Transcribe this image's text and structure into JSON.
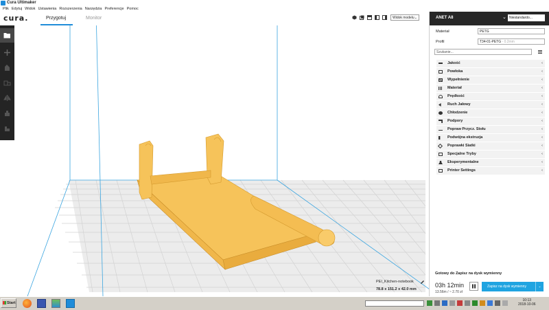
{
  "window": {
    "title": "Cura Ultimaker"
  },
  "menu": [
    "Plik",
    "Edytuj",
    "Widok",
    "Ustawienia",
    "Rozszerzenia",
    "Narzędzia",
    "Preferencje",
    "Pomoc"
  ],
  "header": {
    "logo": "cura.",
    "tabs": [
      {
        "label": "Przygotuj",
        "active": true
      },
      {
        "label": "Monitor",
        "active": false
      }
    ],
    "view_select": "Widok modelu",
    "view_buttons": [
      "3d-view-icon",
      "front-view-icon",
      "top-view-icon",
      "left-view-icon",
      "right-view-icon"
    ]
  },
  "left_tools": [
    "open-file-icon",
    "move-icon",
    "scale-icon",
    "rotate-icon",
    "mirror-icon",
    "per-model-settings-icon",
    "support-blocker-icon"
  ],
  "machine": {
    "name": "ANET A8",
    "extruder": "Niestandardo..."
  },
  "material": {
    "label": "Materiał",
    "value": "PETG"
  },
  "profile": {
    "label": "Profil",
    "value": "T34-01-PETG",
    "suffix": "- 0.2mm"
  },
  "search": {
    "placeholder": "Szukanie..."
  },
  "settings": [
    {
      "label": "Jakość",
      "icon": "quality-icon"
    },
    {
      "label": "Powłoka",
      "icon": "shell-icon"
    },
    {
      "label": "Wypełnienie",
      "icon": "infill-icon"
    },
    {
      "label": "Materiał",
      "icon": "material-icon"
    },
    {
      "label": "Prędkość",
      "icon": "speed-icon"
    },
    {
      "label": "Ruch Jałowy",
      "icon": "travel-icon"
    },
    {
      "label": "Chłodzenie",
      "icon": "cooling-icon"
    },
    {
      "label": "Podpory",
      "icon": "support-icon"
    },
    {
      "label": "Popraw Przycz. Stołu",
      "icon": "adhesion-icon"
    },
    {
      "label": "Podwójna ekstruzja",
      "icon": "dual-extrusion-icon"
    },
    {
      "label": "Poprawki Siatki",
      "icon": "mesh-fixes-icon"
    },
    {
      "label": "Specjalne Tryby",
      "icon": "special-modes-icon"
    },
    {
      "label": "Eksperymentalne",
      "icon": "experimental-icon"
    },
    {
      "label": "Printer Settings",
      "icon": "printer-settings-icon"
    }
  ],
  "status": {
    "ready": "Gotowy do Zapisz na dysk wymienny",
    "time": "03h 12min",
    "usage": "13.56m / ~ 2.70 zł",
    "save_button": "Zapisz na dysk wymienny"
  },
  "object": {
    "name": "PEI_Kitchen-notebook",
    "dims": "78.8 x 151.2 x 42.0 mm"
  },
  "taskbar": {
    "start": "Start",
    "apps": [
      "firefox-icon",
      "save-icon",
      "image-viewer-icon",
      "cura-icon"
    ],
    "time": "10:13",
    "date": "2018-10-06"
  },
  "colors": {
    "model": "#f6c35a",
    "accent": "#1fa4e1",
    "toolbar": "#242424",
    "grid": "#d0d0d0"
  }
}
